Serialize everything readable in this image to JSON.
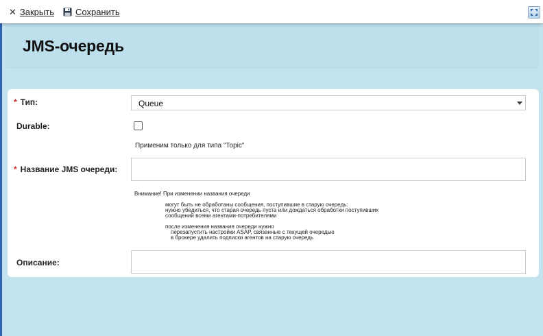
{
  "toolbar": {
    "close_label": "Закрыть",
    "save_label": "Сохранить"
  },
  "page": {
    "title": "JMS-очередь"
  },
  "form": {
    "type": {
      "label": "Тип:",
      "value": "Queue",
      "required_mark": "*"
    },
    "durable": {
      "label": "Durable:",
      "checked": false,
      "hint": "Применим только для типа \"Topic\""
    },
    "queue_name": {
      "label": "Название JMS очереди:",
      "value": "",
      "required_mark": "*",
      "warning": {
        "title": "Внимание! При изменении названия очереди",
        "line1": "могут быть не обработаны сообщения, поступившие в старую очередь:",
        "line2": "нужно убедиться, что старая очередь пуста или дождаться обработки поступивших",
        "line3": "сообщений всеми агентами-потребителями",
        "line4": "после изменения названия очереди нужно",
        "line5": "перезапустить настройки ASAP, связанные с текущей очередью",
        "line6": "в брокере удалить подписки агентов на старую очередь"
      }
    },
    "description": {
      "label": "Описание:",
      "value": ""
    }
  },
  "colors": {
    "background": "#c3e3ee",
    "title_band": "#bde0ec",
    "required_mark": "#d0262b",
    "left_edge": "#2f63b0"
  }
}
